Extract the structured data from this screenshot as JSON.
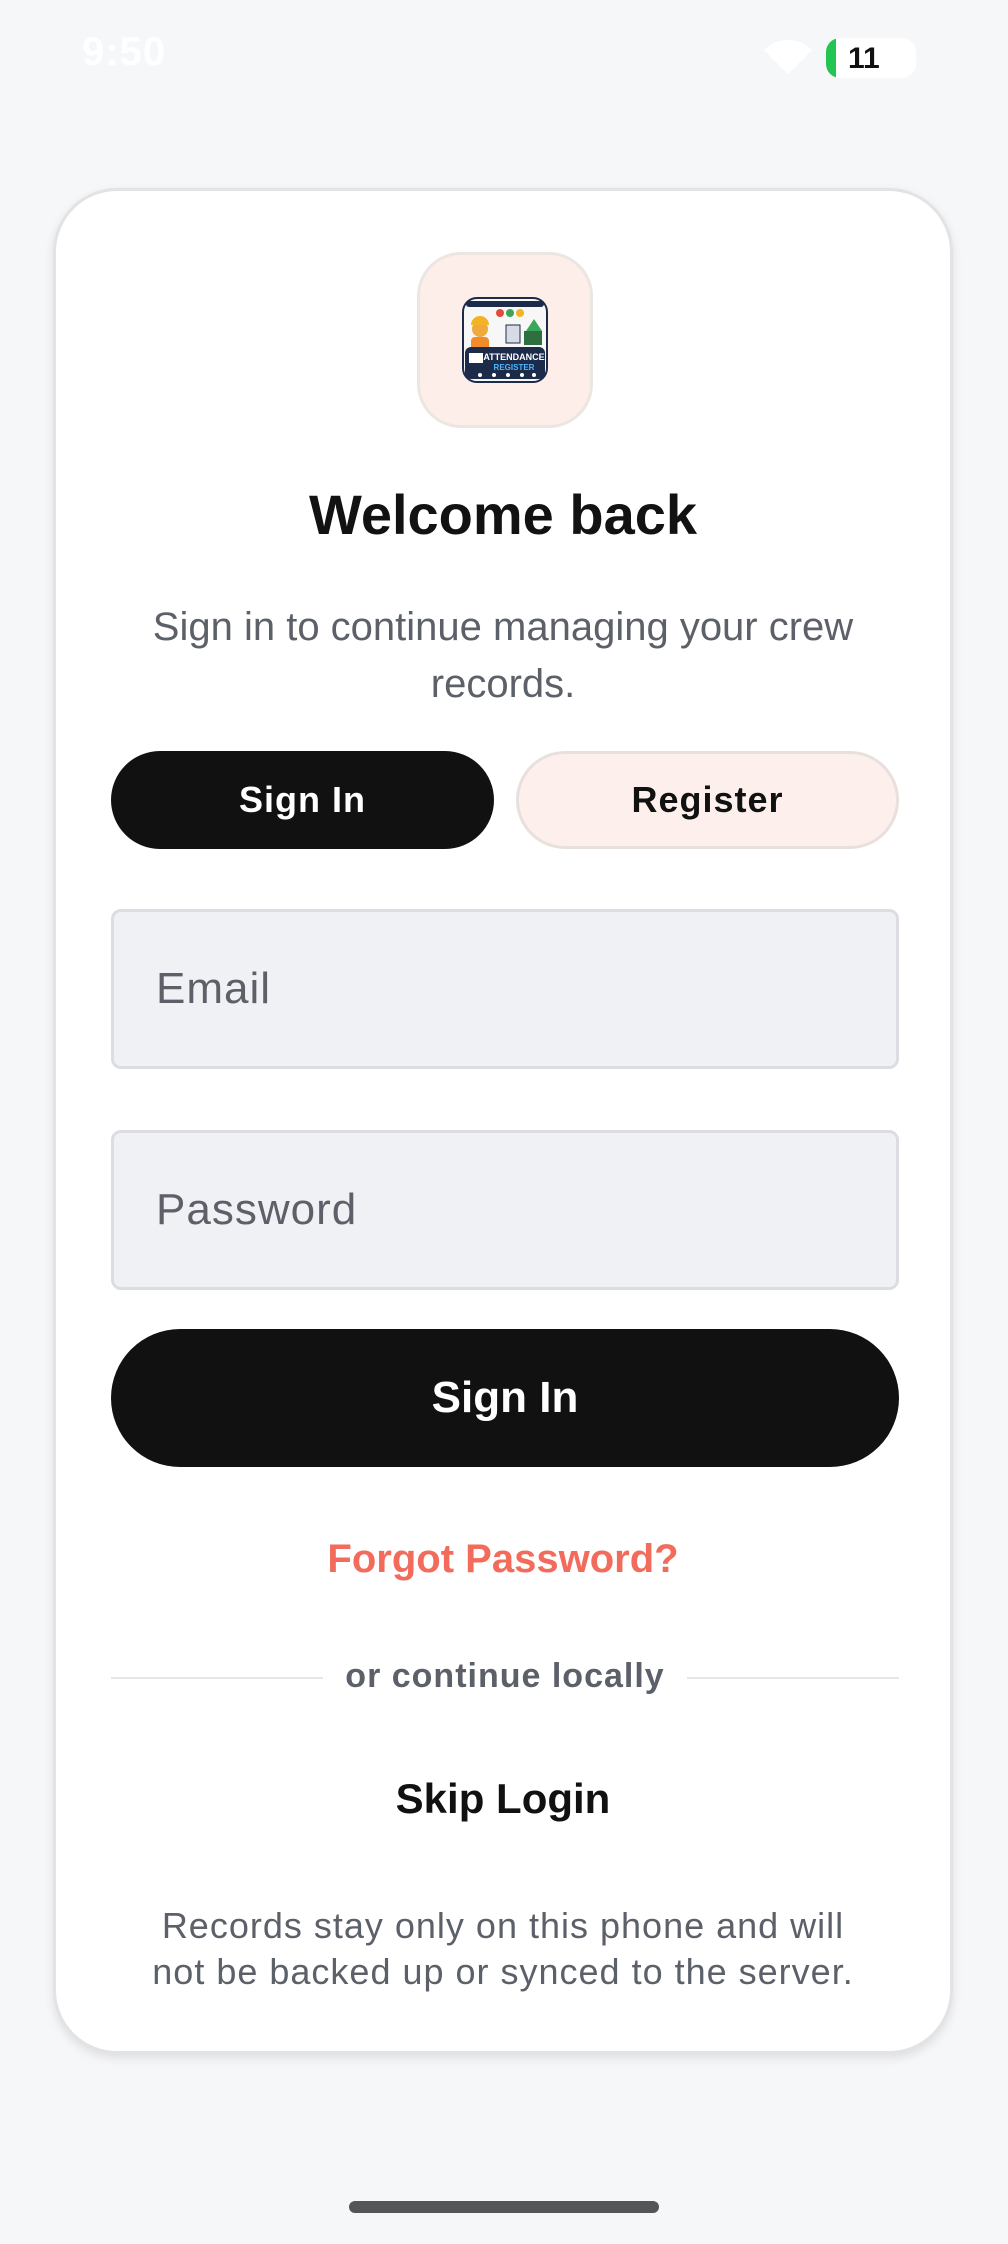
{
  "status_bar": {
    "time": "9:50",
    "battery_level": "11",
    "battery_percent": 11
  },
  "colors": {
    "accent": "#f26b5b",
    "primary_button": "#111111",
    "battery_green": "#23c552"
  },
  "logo": {
    "icon": "attendance-register-logo-icon",
    "text_line1": "ATTENDANCE",
    "text_line2": "REGISTER"
  },
  "header": {
    "title": "Welcome back",
    "subtitle": "Sign in to continue managing your crew records."
  },
  "tabs": {
    "sign_in": "Sign In",
    "register": "Register",
    "selected": "Sign In"
  },
  "form": {
    "email_placeholder": "Email",
    "password_placeholder": "Password",
    "submit_label": "Sign In",
    "forgot_password": "Forgot Password?"
  },
  "divider_text": "or continue locally",
  "skip_login": "Skip Login",
  "footnote": "Records stay only on this phone and will not be backed up or synced to the server."
}
